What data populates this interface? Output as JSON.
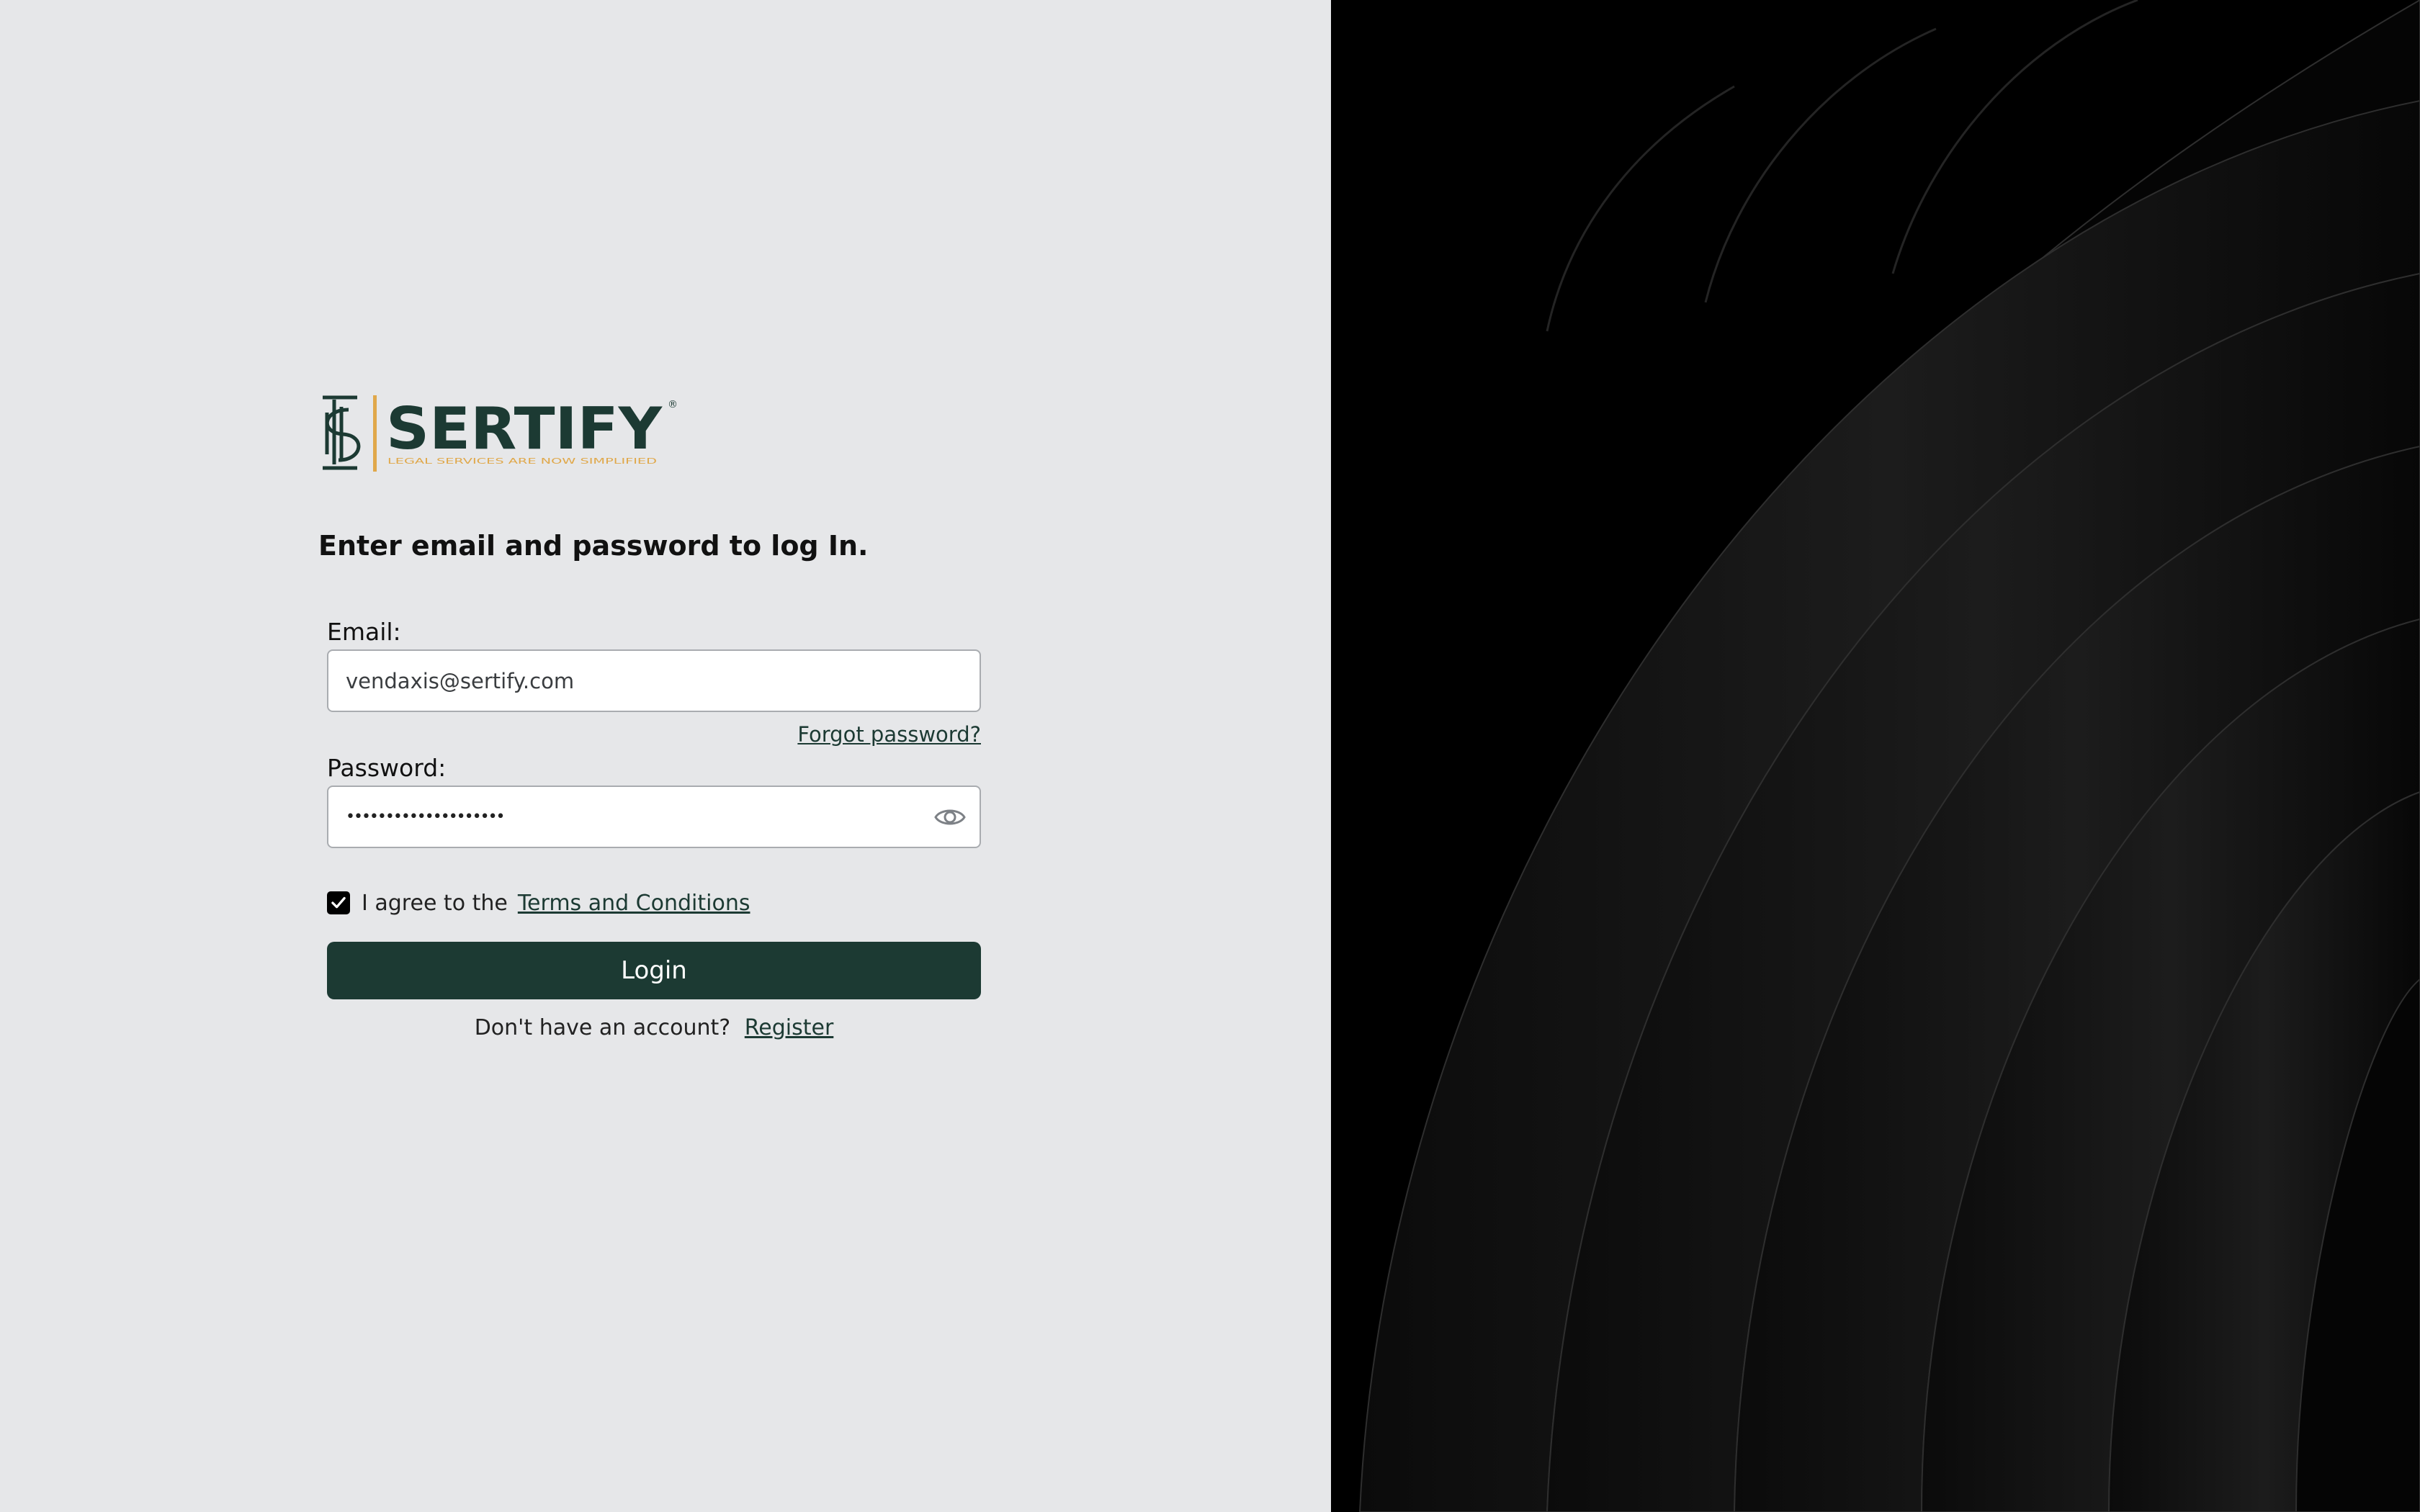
{
  "brand": {
    "name": "SERTIFY",
    "tagline": "LEGAL SERVICES ARE NOW SIMPLIFIED",
    "registered_mark": "®",
    "primary_color": "#1c3a33",
    "accent_color": "#e0a84a"
  },
  "login": {
    "heading": "Enter email and password to log In.",
    "email_label": "Email:",
    "email_value": "vendaxis@sertify.com",
    "forgot_password": "Forgot password?",
    "password_label": "Password:",
    "password_value": "••••••••••••••••••••",
    "agree_prefix": "I agree to the",
    "terms_link": "Terms and Conditions",
    "terms_checked": true,
    "login_button": "Login",
    "no_account_text": "Don't have an account?",
    "register_link": "Register"
  },
  "icons": {
    "password_toggle": "eye-icon",
    "checkbox": "checkmark-icon",
    "logo_mark": "pillar-s-logo-icon"
  },
  "colors": {
    "left_background": "#e6e7e9",
    "right_background": "#000000",
    "button_background": "#1c3a33"
  }
}
